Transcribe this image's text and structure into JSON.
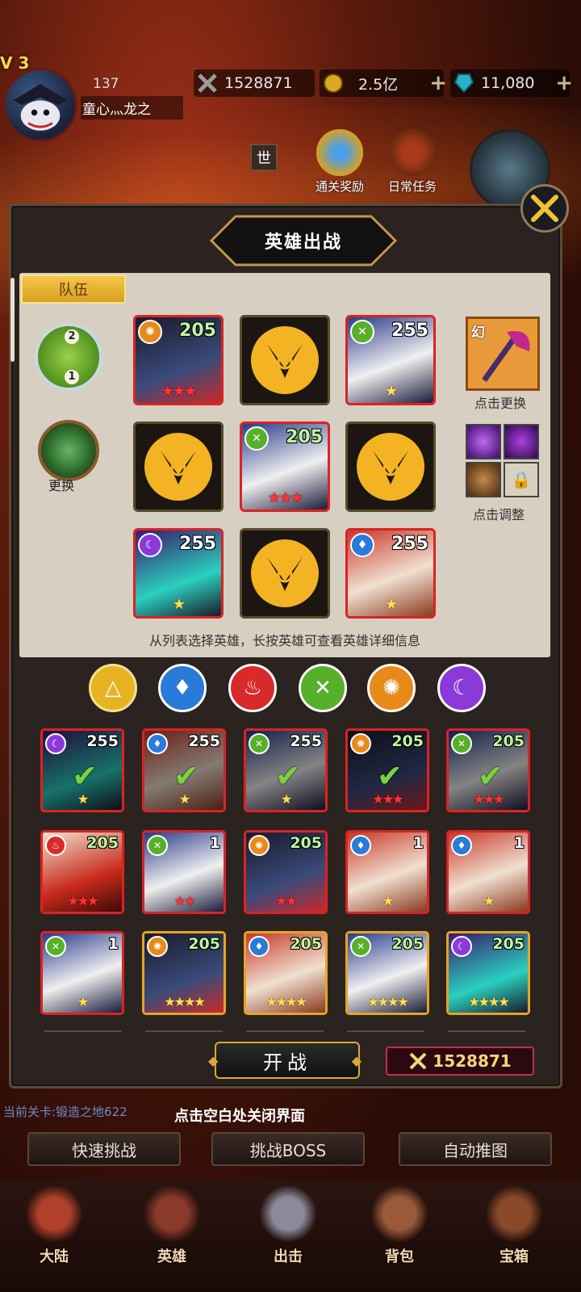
{
  "player": {
    "level_tag": "V 3",
    "id": "137",
    "name": "童心灬龙之"
  },
  "resources": {
    "power": "1528871",
    "gold": "2.5亿",
    "gems": "11,080"
  },
  "top_buttons": {
    "world": "世",
    "clear_reward": "通关奖励",
    "daily_task": "日常任务"
  },
  "panel": {
    "title": "英雄出战",
    "tab_team": "队伍",
    "formation_top": "2",
    "formation_bottom": "1",
    "swap_label": "更换",
    "weapon_tag": "幻",
    "weapon_hint": "点击更换",
    "skills_hint": "点击调整",
    "instruction": "从列表选择英雄，长按英雄可查看英雄详细信息"
  },
  "team_slots": [
    {
      "level": "205",
      "element": "sun",
      "stars": "★★★"
    },
    {
      "empty": true
    },
    {
      "level": "255",
      "element": "wind",
      "stars": "★"
    },
    {
      "empty": true
    },
    {
      "level": "205",
      "element": "wind",
      "stars": "★★★"
    },
    {
      "empty": true
    },
    {
      "level": "255",
      "element": "moon",
      "stars": "★"
    },
    {
      "empty": true
    },
    {
      "level": "255",
      "element": "water",
      "stars": "★"
    }
  ],
  "filters": [
    "all",
    "water",
    "fire",
    "wind",
    "sun",
    "moon"
  ],
  "hero_list": [
    {
      "level": "255",
      "element": "moon",
      "stars": "★",
      "selected": true
    },
    {
      "level": "255",
      "element": "water",
      "stars": "★",
      "selected": true
    },
    {
      "level": "255",
      "element": "wind",
      "stars": "★",
      "selected": true
    },
    {
      "level": "205",
      "element": "sun",
      "stars": "★★★",
      "selected": true
    },
    {
      "level": "205",
      "element": "wind",
      "stars": "★★★",
      "selected": true
    },
    {
      "level": "205",
      "element": "fire",
      "stars": "★★★"
    },
    {
      "level": "1",
      "element": "wind",
      "stars": "★★"
    },
    {
      "level": "205",
      "element": "sun",
      "stars": "★★"
    },
    {
      "level": "1",
      "element": "water",
      "stars": "★"
    },
    {
      "level": "1",
      "element": "water",
      "stars": "★"
    },
    {
      "level": "1",
      "element": "wind",
      "stars": "★"
    },
    {
      "level": "205",
      "element": "sun",
      "stars": "★★★★"
    },
    {
      "level": "205",
      "element": "water",
      "stars": "★★★★"
    },
    {
      "level": "205",
      "element": "wind",
      "stars": "★★★★"
    },
    {
      "level": "205",
      "element": "moon",
      "stars": "★★★★"
    }
  ],
  "battle": {
    "start_label": "开战",
    "power": "1528871"
  },
  "close_hint": "点击空白处关闭界面",
  "stage_text": "当前关卡:锻造之地622",
  "actions": {
    "quick": "快速挑战",
    "boss": "挑战BOSS",
    "auto": "自动推图"
  },
  "nav": [
    "大陆",
    "英雄",
    "出击",
    "背包",
    "宝箱"
  ],
  "colors": {
    "moon": "#8a3ad8",
    "water": "#2a7ad8",
    "fire": "#d82a2a",
    "wind": "#58b02a",
    "sun": "#e88a1a",
    "all": "#e6b422"
  }
}
